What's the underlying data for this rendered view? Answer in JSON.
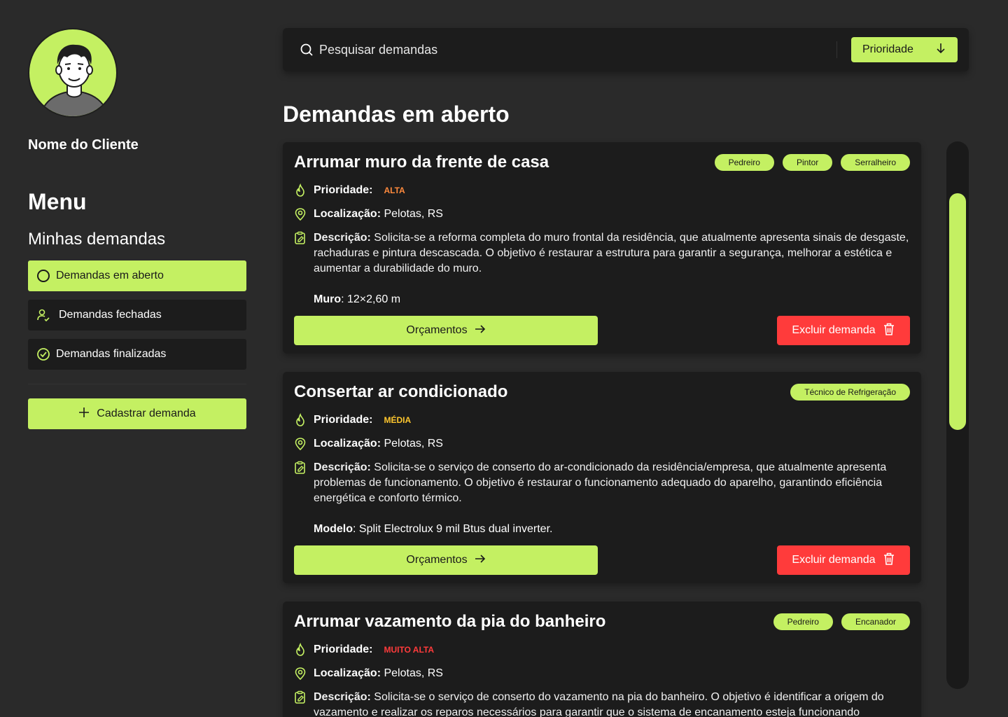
{
  "sidebar": {
    "client_name": "Nome do Cliente",
    "menu_title": "Menu",
    "menu_subtitle": "Minhas demandas",
    "items": [
      {
        "label": "Demandas em aberto",
        "icon": "circle-icon"
      },
      {
        "label": "Demandas fechadas",
        "icon": "user-check-icon"
      },
      {
        "label": "Demandas finalizadas",
        "icon": "check-circle-icon"
      }
    ],
    "add_button": "Cadastrar demanda"
  },
  "search": {
    "placeholder": "Pesquisar demandas",
    "sort_label": "Prioridade"
  },
  "page_title": "Demandas em aberto",
  "labels": {
    "priority": "Prioridade:",
    "location": "Localização:",
    "description": "Descrição:",
    "quotes_button": "Orçamentos",
    "delete_button": "Excluir demanda"
  },
  "cards": [
    {
      "title": "Arrumar muro da frente de casa",
      "tags": [
        "Pedreiro",
        "Pintor",
        "Serralheiro"
      ],
      "priority": "ALTA",
      "location": "Pelotas, RS",
      "description": "Solicita-se a reforma completa do muro frontal da residência, que atualmente apresenta sinais de desgaste, rachaduras e pintura descascada. O objetivo é restaurar a estrutura para garantir a segurança, melhorar a estética e aumentar a durabilidade do muro.",
      "extra_label": "Muro",
      "extra_value": ": 12×2,60 m"
    },
    {
      "title": "Consertar ar condicionado",
      "tags": [
        "Técnico de Refrigeração"
      ],
      "priority": "MÉDIA",
      "location": "Pelotas, RS",
      "description": "Solicita-se o serviço de conserto do ar-condicionado da residência/empresa, que atualmente apresenta problemas de funcionamento. O objetivo é restaurar o funcionamento adequado do aparelho, garantindo eficiência energética e conforto térmico.",
      "extra_label": "Modelo",
      "extra_value": ": Split Electrolux 9 mil Btus dual inverter."
    },
    {
      "title": "Arrumar vazamento da pia do banheiro",
      "tags": [
        "Pedreiro",
        "Encanador"
      ],
      "priority": "MUITO ALTA",
      "location": "Pelotas, RS",
      "description": "Solicita-se o serviço de conserto do vazamento na pia do banheiro. O objetivo é identificar a origem do vazamento e realizar os reparos necessários para garantir que o sistema de encanamento esteja funcionando",
      "extra_label": "",
      "extra_value": ""
    }
  ],
  "colors": {
    "accent": "#c4f062",
    "danger": "#ff3b3b",
    "priority_alta": "#ff8a3d",
    "priority_media": "#ffc72e",
    "priority_muito_alta": "#ff3b3b"
  }
}
